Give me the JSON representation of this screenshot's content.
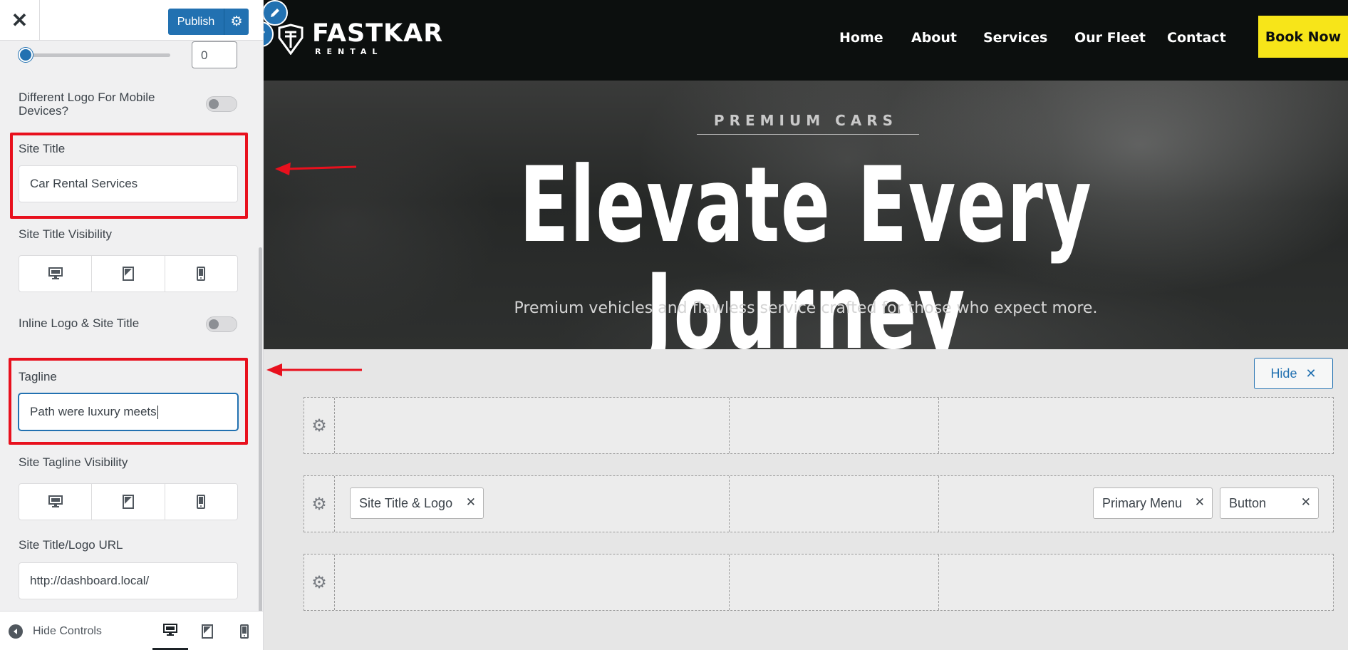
{
  "sidebar": {
    "publish_label": "Publish",
    "number_value": "0",
    "mobile_logo_label": "Different Logo For Mobile Devices?",
    "site_title_label": "Site Title",
    "site_title_value": "Car Rental Services",
    "title_visibility_label": "Site Title Visibility",
    "inline_logo_label": "Inline Logo & Site Title",
    "tagline_label": "Tagline",
    "tagline_value": "Path were luxury meets",
    "tagline_visibility_label": "Site Tagline Visibility",
    "logo_url_label": "Site Title/Logo URL",
    "logo_url_value": "http://dashboard.local/",
    "hide_controls_label": "Hide Controls"
  },
  "site": {
    "logo_name": "FASTKAR",
    "logo_sub": "RENTAL",
    "nav": [
      "Home",
      "About",
      "Services",
      "Our Fleet",
      "Contact"
    ],
    "cta": "Book Now"
  },
  "hero": {
    "eyebrow": "PREMIUM CARS",
    "title": "Elevate Every Journey",
    "subtitle": "Premium vehicles and flawless service crafted for those who expect more."
  },
  "builder": {
    "hide_label": "Hide",
    "chip_logo": "Site Title & Logo",
    "chip_menu": "Primary Menu",
    "chip_button": "Button"
  },
  "colors": {
    "accent": "#2271b1",
    "highlight": "#e8101d",
    "cta": "#f7e519",
    "header_bg": "#0c0f0e"
  }
}
